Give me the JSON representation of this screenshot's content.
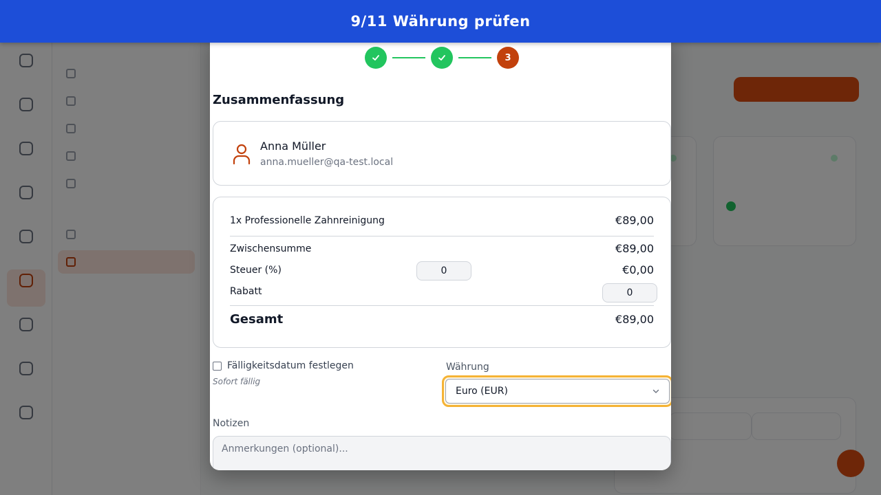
{
  "banner": {
    "title": "9/11 Währung prüfen"
  },
  "stepper": {
    "current_step": "3"
  },
  "summary": {
    "title": "Zusammenfassung",
    "customer": {
      "name": "Anna Müller",
      "email": "anna.mueller@qa-test.local"
    },
    "line_item": {
      "label": "1x Professionelle Zahnreinigung",
      "amount": "€89,00"
    },
    "subtotal": {
      "label": "Zwischensumme",
      "amount": "€89,00"
    },
    "tax": {
      "label": "Steuer (%)",
      "input_value": "0",
      "amount": "€0,00"
    },
    "discount": {
      "label": "Rabatt",
      "input_value": "0"
    },
    "total": {
      "label": "Gesamt",
      "amount": "€89,00"
    }
  },
  "due_date": {
    "label": "Fälligkeitsdatum festlegen",
    "checked": false,
    "hint": "Sofort fällig"
  },
  "currency": {
    "label": "Währung",
    "selected": "Euro (EUR)"
  },
  "notes": {
    "label": "Notizen",
    "placeholder": "Anmerkungen (optional)..."
  },
  "colors": {
    "banner": "#1d4ed8",
    "step_done": "#22c55e",
    "step_current": "#c2410c",
    "highlight": "#f5b335",
    "brand": "#dc4d11"
  }
}
